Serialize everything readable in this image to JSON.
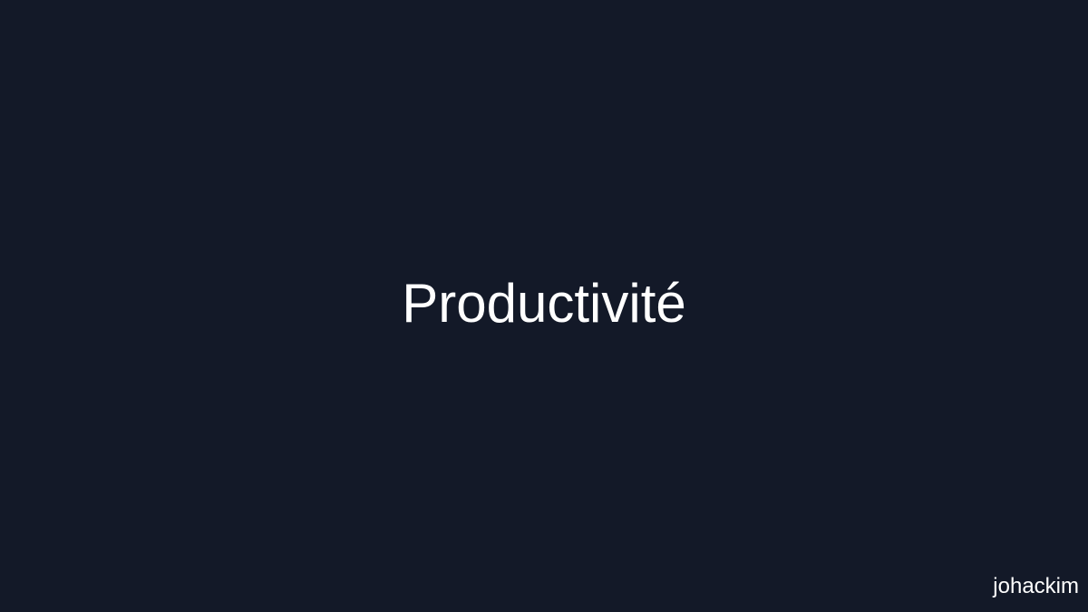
{
  "slide": {
    "title": "Productivité",
    "author": "johackim",
    "colors": {
      "background": "#131928",
      "text": "#ffffff"
    }
  }
}
